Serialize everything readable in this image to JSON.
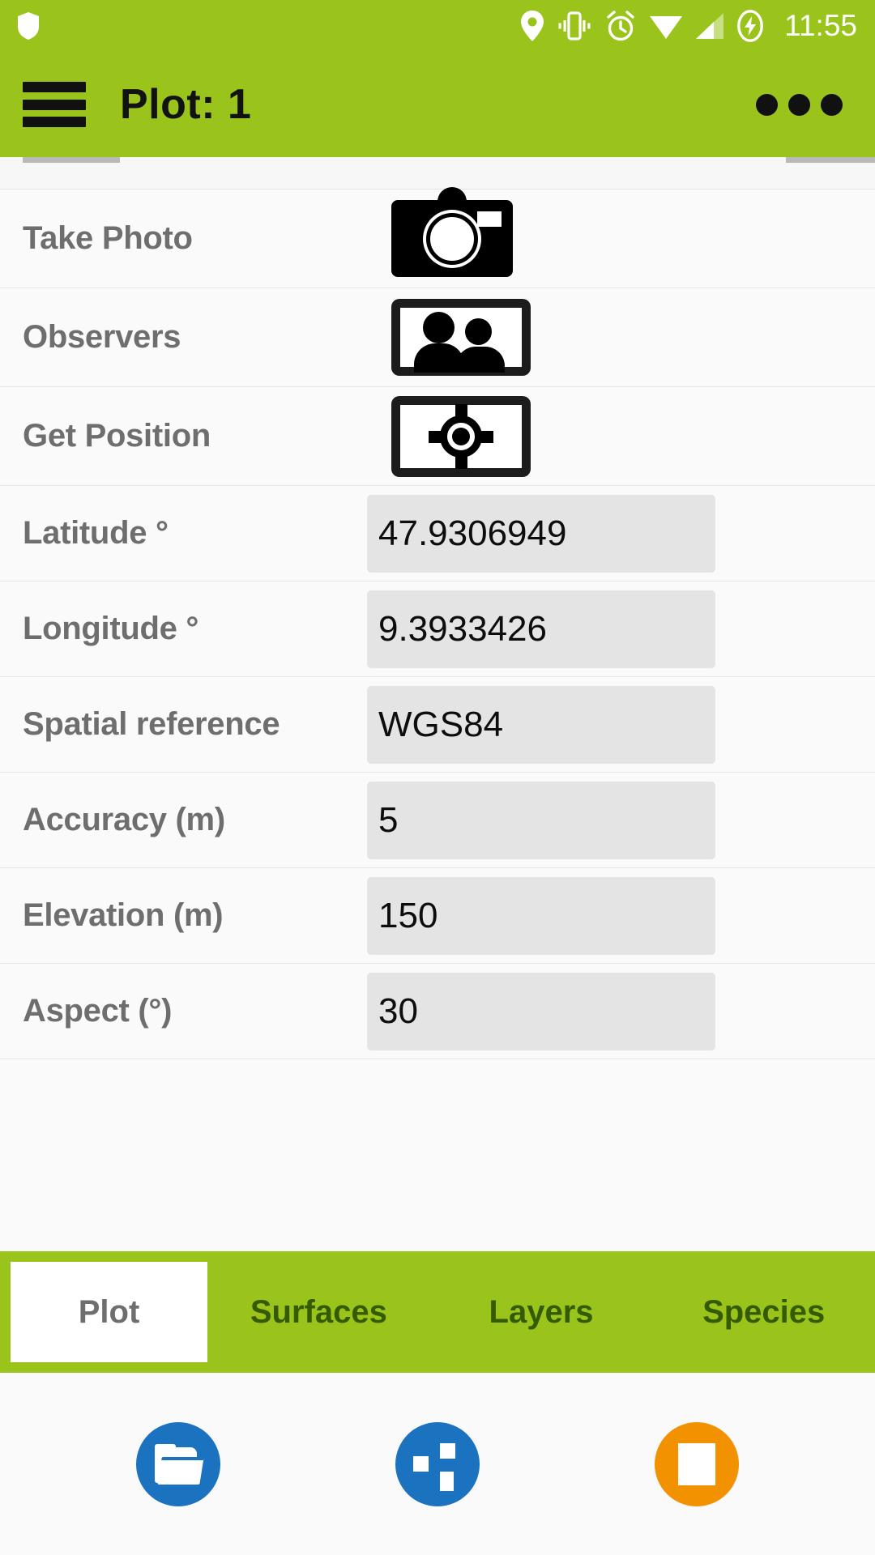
{
  "status_bar": {
    "time": "11:55",
    "icons": [
      "shield-icon",
      "location-pin-icon",
      "vibrate-icon",
      "alarm-clock-icon",
      "wifi-icon",
      "cellular-signal-icon",
      "battery-charging-icon"
    ]
  },
  "app_bar": {
    "title": "Plot: 1",
    "menu_icon": "hamburger-menu-icon",
    "overflow_icon": "overflow-menu-icon"
  },
  "theme": {
    "accent_green": "#9ac31c",
    "blue": "#1b72bf",
    "orange": "#f29200",
    "field_bg": "#e4e4e4",
    "label_color": "#6e6e6e"
  },
  "form": {
    "rows": [
      {
        "label": "Take Photo",
        "type": "icon",
        "icon": "camera-icon"
      },
      {
        "label": "Observers",
        "type": "icon",
        "icon": "observers-people-icon"
      },
      {
        "label": "Get Position",
        "type": "icon",
        "icon": "gps-crosshair-icon"
      },
      {
        "label": "Latitude °",
        "type": "field",
        "value": "47.9306949"
      },
      {
        "label": "Longitude °",
        "type": "field",
        "value": "9.3933426"
      },
      {
        "label": "Spatial reference",
        "type": "field",
        "value": "WGS84"
      },
      {
        "label": "Accuracy (m)",
        "type": "field",
        "value": "5"
      },
      {
        "label": "Elevation (m)",
        "type": "field",
        "value": "150"
      },
      {
        "label": "Aspect (°)",
        "type": "field",
        "value": "30"
      }
    ]
  },
  "tabs": [
    {
      "label": "Plot",
      "active": true
    },
    {
      "label": "Surfaces",
      "active": false
    },
    {
      "label": "Layers",
      "active": false
    },
    {
      "label": "Species",
      "active": false
    }
  ],
  "bottom_nav": [
    {
      "name": "open-folder-button",
      "icon": "folder-open-icon",
      "color": "#1b72bf"
    },
    {
      "name": "recent-apps-button",
      "icon": "apps-squares-icon",
      "color": "#1b72bf"
    },
    {
      "name": "stop-button",
      "icon": "stop-square-icon",
      "color": "#f29200"
    }
  ]
}
